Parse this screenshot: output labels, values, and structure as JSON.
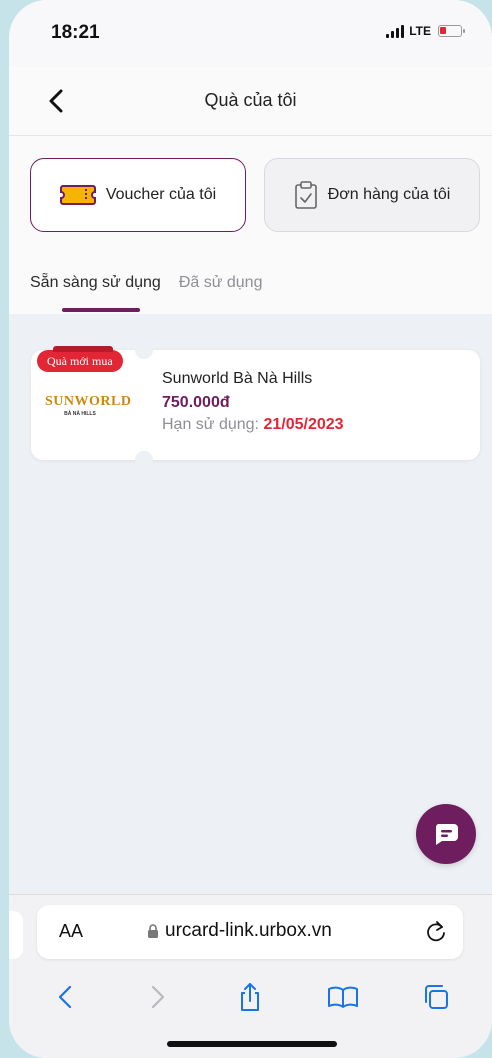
{
  "status_bar": {
    "time": "18:21",
    "network": "LTE"
  },
  "header": {
    "title": "Quà của tôi"
  },
  "segments": {
    "voucher_label": "Voucher của tôi",
    "order_label": "Đơn hàng của tôi"
  },
  "subtabs": {
    "ready_label": "Sẵn sàng sử dụng",
    "used_label": "Đã sử dụng"
  },
  "vouchers": [
    {
      "badge": "Quà mới mua",
      "logo_text": "SUNWORLD",
      "logo_subtext": "BÀ NÀ HILLS",
      "name": "Sunworld Bà Nà Hills",
      "price": "750.000đ",
      "expiry_label": "Hạn sử dụng:",
      "expiry_date": "21/05/2023"
    }
  ],
  "browser": {
    "aa_label": "AA",
    "url": "urcard-link.urbox.vn"
  },
  "colors": {
    "brand": "#6e1d5f",
    "accent_red": "#e32636",
    "content_bg": "#edf0f4",
    "ios_blue": "#1a73e8"
  },
  "icons": {
    "back": "chevron-left-icon",
    "voucher": "ticket-icon",
    "order": "clipboard-check-icon",
    "chat": "chat-bubble-icon",
    "lock": "lock-icon",
    "reload": "reload-icon",
    "share": "share-icon",
    "bookmarks": "book-icon",
    "tabs": "tabs-icon"
  }
}
